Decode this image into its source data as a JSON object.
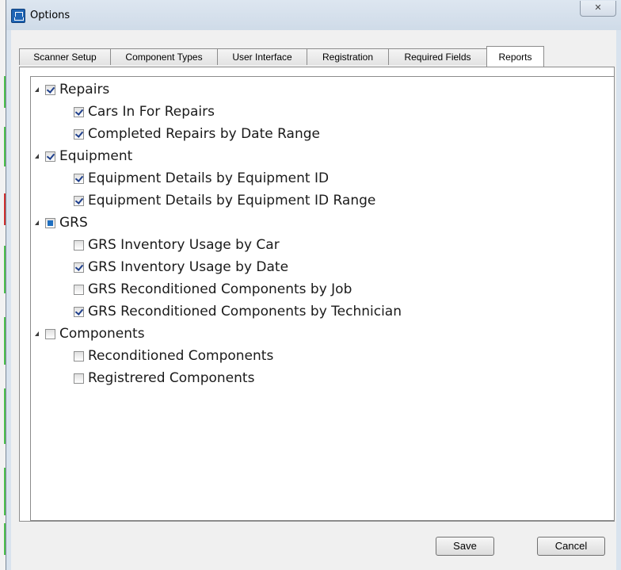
{
  "window": {
    "title": "Options",
    "close_glyph": "✕"
  },
  "tabs": [
    {
      "label": "Scanner Setup",
      "active": false
    },
    {
      "label": "Component Types",
      "active": false
    },
    {
      "label": "User Interface",
      "active": false
    },
    {
      "label": "Registration",
      "active": false
    },
    {
      "label": "Required Fields",
      "active": false
    },
    {
      "label": "Reports",
      "active": true
    }
  ],
  "tree": [
    {
      "label": "Repairs",
      "state": "checked",
      "expanded": true,
      "children": [
        {
          "label": "Cars In For Repairs",
          "checked": true
        },
        {
          "label": "Completed Repairs by Date Range",
          "checked": true
        }
      ]
    },
    {
      "label": "Equipment",
      "state": "checked",
      "expanded": true,
      "children": [
        {
          "label": "Equipment Details by Equipment ID",
          "checked": true
        },
        {
          "label": "Equipment Details by Equipment ID Range",
          "checked": true
        }
      ]
    },
    {
      "label": "GRS",
      "state": "partial",
      "expanded": true,
      "children": [
        {
          "label": "GRS Inventory Usage by Car",
          "checked": false
        },
        {
          "label": "GRS Inventory Usage by Date",
          "checked": true
        },
        {
          "label": "GRS Reconditioned Components by Job",
          "checked": false
        },
        {
          "label": "GRS Reconditioned Components by Technician",
          "checked": true
        }
      ]
    },
    {
      "label": "Components",
      "state": "unchecked",
      "expanded": true,
      "children": [
        {
          "label": "Reconditioned Components",
          "checked": false
        },
        {
          "label": "Registrered Components",
          "checked": false
        }
      ]
    }
  ],
  "buttons": {
    "save": "Save",
    "cancel": "Cancel"
  },
  "colors": {
    "checkmark": "#1e3f8c",
    "partial_fill": "#1f6fc0",
    "app_icon": "#1e64b4"
  }
}
